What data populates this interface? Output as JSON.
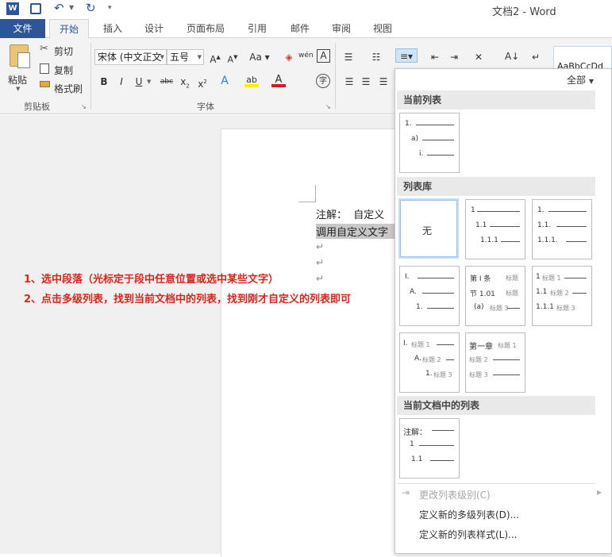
{
  "window": {
    "title": "文档2 - Word"
  },
  "tabs": [
    "文件",
    "开始",
    "插入",
    "设计",
    "页面布局",
    "引用",
    "邮件",
    "审阅",
    "视图"
  ],
  "ribbon": {
    "clipboard": {
      "paste": "粘贴",
      "cut": "剪切",
      "copy": "复制",
      "format_painter": "格式刷",
      "label": "剪贴板"
    },
    "font": {
      "font_name": "宋体 (中文正文",
      "font_size": "五号",
      "label": "字体"
    },
    "styles": {
      "preview": "AaBbCcDd"
    }
  },
  "document": {
    "line1": "注解：  自定义",
    "line2": "调用自定义文字"
  },
  "annotations": [
    "1、选中段落（光标定于段中任意位置或选中某些文字）",
    "2、点击多级列表，找到当前文档中的列表，找到刚才自定义的列表即可"
  ],
  "gallery": {
    "filter": "全部",
    "current_list": "当前列表",
    "library": "列表库",
    "in_document": "当前文档中的列表",
    "none": "无",
    "menu": {
      "change_level": "更改列表级别(C)",
      "define_new_list": "定义新的多级列表(D)...",
      "define_new_style": "定义新的列表样式(L)..."
    },
    "thumbs": {
      "current": [
        "1.",
        "a)",
        "i."
      ],
      "lib1": [
        "1",
        "1.1",
        "1.1.1"
      ],
      "lib2": [
        "1.",
        "1.1.",
        "1.1.1."
      ],
      "lib3": [
        "I.",
        "A.",
        "1."
      ],
      "lib4": [
        "第 I 条",
        "节 1.01",
        "(a)",
        "标题",
        "标题",
        "标题 3"
      ],
      "lib5": [
        "1",
        "1.1",
        "1.1.1",
        "标题 1",
        "标题 2",
        "标题 3"
      ],
      "lib6": [
        "I.",
        "A.",
        "1.",
        "标题 1",
        "标题 2",
        "标题 3"
      ],
      "lib7": [
        "第一章",
        "标题 1",
        "标题 2",
        "标题 3"
      ],
      "doc": [
        "注解：",
        "1",
        "1.1"
      ]
    }
  },
  "colors": {
    "accent": "#2b579a",
    "annotation": "#d9261c"
  }
}
